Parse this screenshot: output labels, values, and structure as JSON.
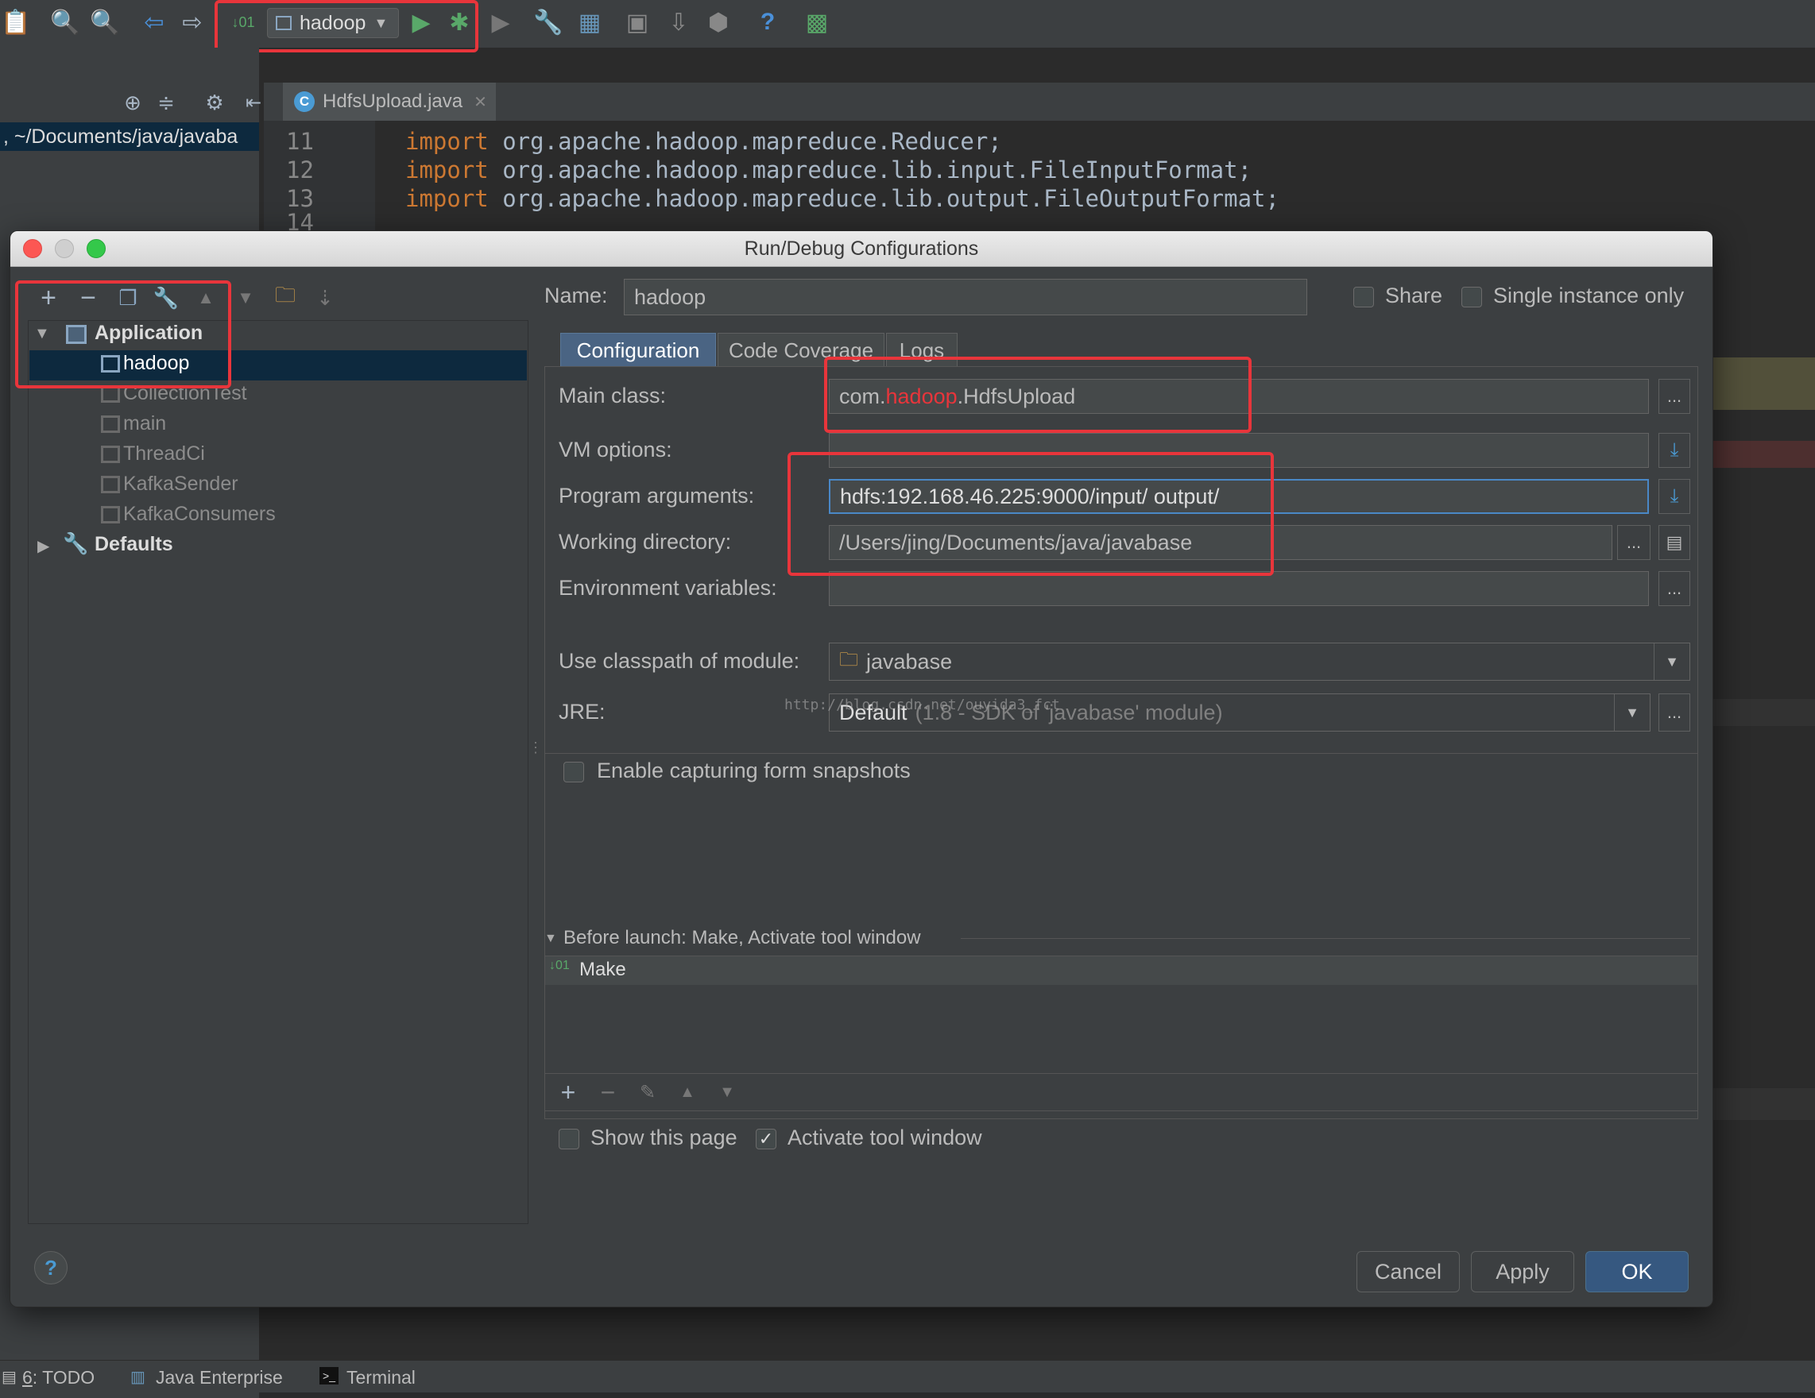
{
  "toolbar": {
    "run_config": "hadoop"
  },
  "editor": {
    "project_path": ", ~/Documents/java/javaba",
    "tab_name": "HdfsUpload.java",
    "lines": [
      {
        "num": "11",
        "kw": "import",
        "code": " org.apache.hadoop.mapreduce.Reducer;"
      },
      {
        "num": "12",
        "kw": "import",
        "code": " org.apache.hadoop.mapreduce.lib.input.FileInputFormat;"
      },
      {
        "num": "13",
        "kw": "import",
        "code": " org.apache.hadoop.mapreduce.lib.output.FileOutputFormat;"
      },
      {
        "num": "14",
        "kw": "",
        "code": ""
      }
    ]
  },
  "dialog": {
    "title": "Run/Debug Configurations",
    "tree": {
      "application": "Application",
      "items": [
        "hadoop",
        "CollectionTest",
        "main",
        "ThreadCi",
        "KafkaSender",
        "KafkaConsumers"
      ],
      "defaults": "Defaults"
    },
    "name_label": "Name:",
    "name_value": "hadoop",
    "share_label": "Share",
    "single_instance_label": "Single instance only",
    "tabs": [
      "Configuration",
      "Code Coverage",
      "Logs"
    ],
    "main_class_label": "Main class:",
    "main_class_prefix": "com.",
    "main_class_highlight": "hadoop",
    "main_class_suffix": ".HdfsUpload",
    "vm_options_label": "VM options:",
    "vm_options_value": "",
    "program_args_label": "Program arguments:",
    "program_args_value": "hdfs:192.168.46.225:9000/input/ output/",
    "working_dir_label": "Working directory:",
    "working_dir_value": "/Users/jing/Documents/java/javabase",
    "env_vars_label": "Environment variables:",
    "env_vars_value": "",
    "classpath_label": "Use classpath of module:",
    "classpath_value": "javabase",
    "jre_label": "JRE:",
    "jre_value": "Default",
    "jre_hint": "(1.8 - SDK of 'javabase' module)",
    "watermark": "http://blog.csdn.net/ouyida3_fct",
    "snapshots_label": "Enable capturing form snapshots",
    "before_launch_label": "Before launch: Make, Activate tool window",
    "make_label": "Make",
    "show_page_label": "Show this page",
    "activate_tool_label": "Activate tool window",
    "buttons": {
      "cancel": "Cancel",
      "apply": "Apply",
      "ok": "OK"
    },
    "ellipsis": "..."
  },
  "statusbar": {
    "todo_num": "6",
    "todo": ": TODO",
    "java_enterprise": "Java Enterprise",
    "terminal": "Terminal"
  },
  "colors": {
    "accent_red": "#e8353b",
    "keyword": "#cc7832",
    "selection": "#0d293e",
    "run_green": "#59a869"
  }
}
